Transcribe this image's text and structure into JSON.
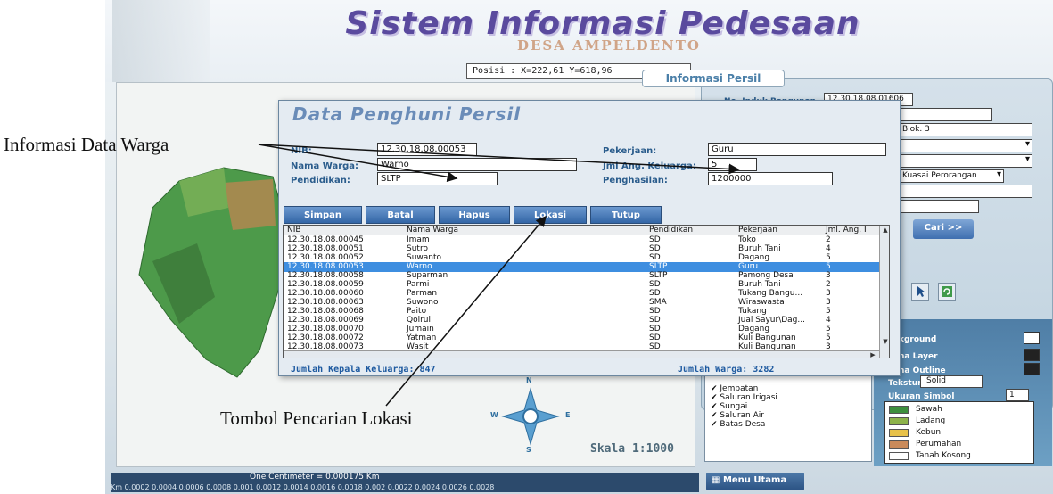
{
  "app": {
    "title": "Sistem Informasi Pedesaan",
    "subtitle": "DESA AMPELDENTO",
    "position_label": "Posisi : X=222,61 Y=618,96"
  },
  "info_panel": {
    "title": "Informasi Persil",
    "no_induk_label": "No. Induk Bangunan",
    "no_induk_value": "12.30.18.08.01606",
    "blok_value": "Blok. 3",
    "kuasa_value": "Kuasai Perorangan",
    "cari_label": "Cari >>"
  },
  "dialog": {
    "title": "Data Penghuni Persil",
    "fields": {
      "nib_label": "NIB:",
      "nib_value": "12.30.18.08.00053",
      "nama_label": "Nama Warga:",
      "nama_value": "Warno",
      "pendidikan_label": "Pendidikan:",
      "pendidikan_value": "SLTP",
      "pekerjaan_label": "Pekerjaan:",
      "pekerjaan_value": "Guru",
      "jml_label": "Jml Ang. Keluarga:",
      "jml_value": "5",
      "penghasilan_label": "Penghasilan:",
      "penghasilan_value": "1200000"
    },
    "buttons": {
      "simpan": "Simpan",
      "batal": "Batal",
      "hapus": "Hapus",
      "lokasi": "Lokasi",
      "tutup": "Tutup"
    },
    "table": {
      "headers": [
        "NIB",
        "Nama Warga",
        "Pendidikan",
        "Pekerjaan",
        "Jml. Ang. I"
      ],
      "rows": [
        [
          "12.30.18.08.00045",
          "Imam",
          "SD",
          "Toko",
          "2"
        ],
        [
          "12.30.18.08.00051",
          "Sutro",
          "SD",
          "Buruh Tani",
          "4"
        ],
        [
          "12.30.18.08.00052",
          "Suwanto",
          "SD",
          "Dagang",
          "5"
        ],
        [
          "12.30.18.08.00053",
          "Warno",
          "SLTP",
          "Guru",
          "5"
        ],
        [
          "12.30.18.08.00058",
          "Suparman",
          "SLTP",
          "Pamong Desa",
          "3"
        ],
        [
          "12.30.18.08.00059",
          "Parmi",
          "SD",
          "Buruh Tani",
          "2"
        ],
        [
          "12.30.18.08.00060",
          "Parman",
          "SD",
          "Tukang Bangu...",
          "3"
        ],
        [
          "12.30.18.08.00063",
          "Suwono",
          "SMA",
          "Wiraswasta",
          "3"
        ],
        [
          "12.30.18.08.00068",
          "Paito",
          "SD",
          "Tukang",
          "5"
        ],
        [
          "12.30.18.08.00069",
          "Qoirul",
          "SD",
          "Jual Sayur\\Dag...",
          "4"
        ],
        [
          "12.30.18.08.00070",
          "Jumain",
          "SD",
          "Dagang",
          "5"
        ],
        [
          "12.30.18.08.00072",
          "Yatman",
          "SD",
          "Kuli Bangunan",
          "5"
        ],
        [
          "12.30.18.08.00073",
          "Wasit",
          "SD",
          "Kuli Bangunan",
          "3"
        ]
      ],
      "selected_row": 3
    },
    "footer_left": "Jumlah Kepala Keluarga: 847",
    "footer_right": "Jumlah Warga: 3282"
  },
  "layers": {
    "items": [
      "Jembatan",
      "Saluran Irigasi",
      "Sungai",
      "Saluran Air",
      "Batas Desa"
    ]
  },
  "symbol_panel": {
    "background_label": "kground",
    "layer_label": "na Layer",
    "outline_label": "na Outline",
    "tekstur_label": "Tekstur",
    "tekstur_value": "Solid",
    "ukuran_label": "Ukuran Simbol",
    "ukuran_value": "1",
    "symbols": [
      {
        "name": "Sawah",
        "color": "#3d8f3d"
      },
      {
        "name": "Ladang",
        "color": "#8db34a"
      },
      {
        "name": "Kebun",
        "color": "#e8c24a"
      },
      {
        "name": "Perumahan",
        "color": "#c98a5a"
      },
      {
        "name": "Tanah Kosong",
        "color": "#ffffff"
      }
    ]
  },
  "map": {
    "scale_label": "Skala 1:1000",
    "compass_n": "N",
    "compass_s": "S",
    "compass_e": "E",
    "compass_w": "W"
  },
  "bottom": {
    "scale_cm": "One Centimeter = 0.000175 Km",
    "scale_ticks": "Km  0.0002  0.0004  0.0006  0.0008  0.001  0.0012  0.0014  0.0016  0.0018  0.002  0.0022  0.0024  0.0026 0.0028",
    "menu_label": "Menu Utama"
  },
  "annotations": {
    "informasi": "Informasi Data Warga",
    "tombol": "Tombol Pencarian Lokasi"
  }
}
